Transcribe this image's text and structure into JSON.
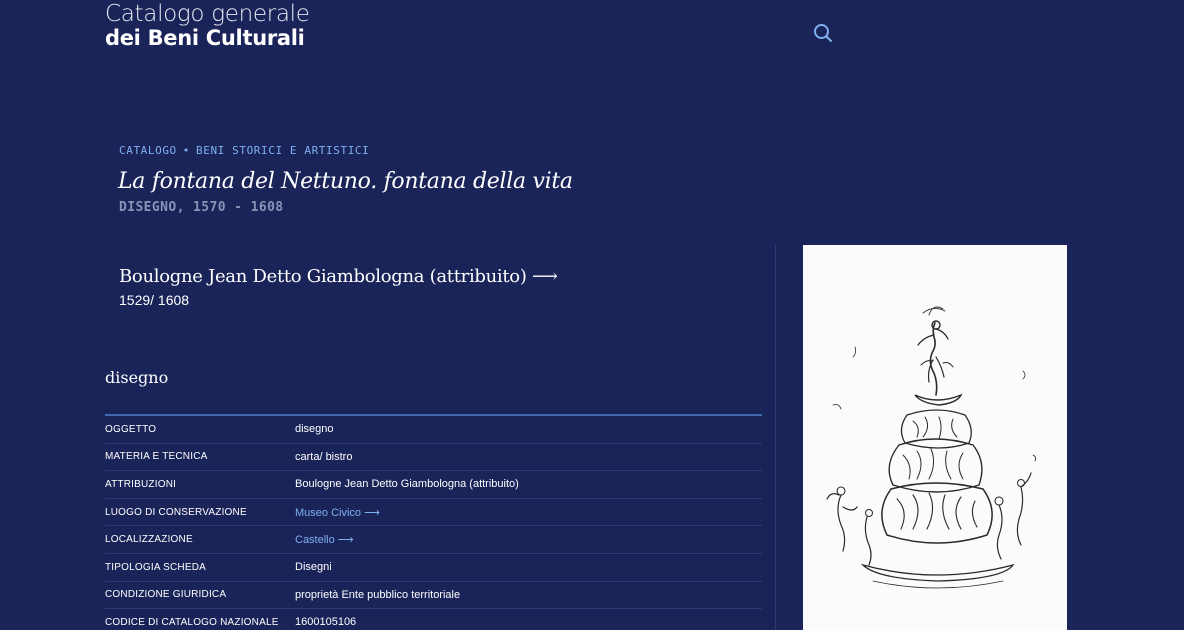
{
  "header": {
    "title_line1": "Catalogo generale",
    "title_line2": "dei Beni Culturali",
    "search_icon": "search-icon"
  },
  "breadcrumb": {
    "items": [
      "CATALOGO",
      "BENI STORICI E ARTISTICI"
    ],
    "separator": "•"
  },
  "title": "La fontana del Nettuno. fontana della vita",
  "subtitle": "DISEGNO, 1570 - 1608",
  "author": {
    "name": "Boulogne Jean Detto Giambologna (attribuito) ⟶",
    "dates": "1529/ 1608"
  },
  "section_heading": "disegno",
  "details": [
    {
      "label": "OGGETTO",
      "value": "disegno"
    },
    {
      "label": "MATERIA E TECNICA",
      "value": "carta/ bistro"
    },
    {
      "label": "ATTRIBUZIONI",
      "value": "Boulogne Jean Detto Giambologna (attribuito)"
    },
    {
      "label": "LUOGO DI CONSERVAZIONE",
      "value": "Museo Civico ⟶"
    },
    {
      "label": "LOCALIZZAZIONE",
      "value": "Castello ⟶"
    },
    {
      "label": "TIPOLOGIA SCHEDA",
      "value": "Disegni"
    },
    {
      "label": "CONDIZIONE GIURIDICA",
      "value": "proprietà Ente pubblico territoriale"
    },
    {
      "label": "CODICE DI CATALOGO NAZIONALE",
      "value": "1600105106"
    }
  ],
  "colors": {
    "background": "#1a2459",
    "accent_link": "#7fb0ef",
    "table_rule": "#3f6ab0"
  }
}
